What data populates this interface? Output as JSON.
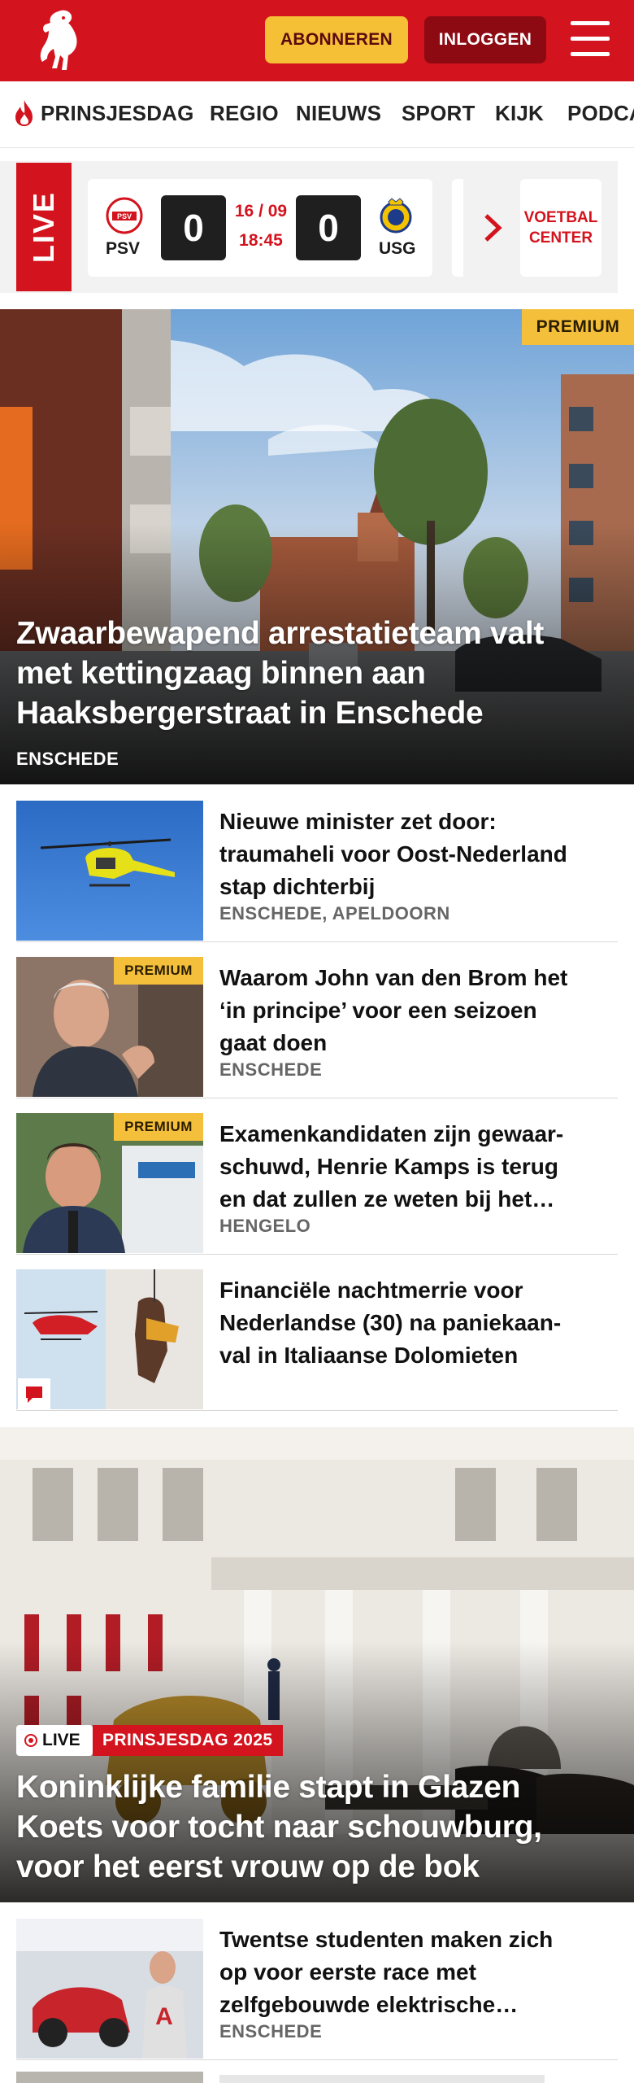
{
  "header": {
    "subscribe_label": "ABONNEREN",
    "login_label": "INLOGGEN",
    "colors": {
      "brand_red": "#d3131d",
      "subscribe_yellow": "#f5bf36",
      "login_dark_red": "#8e0a13"
    }
  },
  "nav": {
    "items": [
      {
        "label": "PRINSJESDAG",
        "icon": "flame-icon"
      },
      {
        "label": "REGIO"
      },
      {
        "label": "NIEUWS"
      },
      {
        "label": "SPORT"
      },
      {
        "label": "KIJK"
      },
      {
        "label": "PODCA"
      }
    ]
  },
  "live": {
    "label": "LIVE",
    "match": {
      "home": "PSV",
      "away": "USG",
      "home_score": "0",
      "away_score": "0",
      "date": "16 / 09",
      "time": "18:45"
    },
    "voetbal_center_line1": "VOETBAL",
    "voetbal_center_line2": "CENTER"
  },
  "hero1": {
    "badge": "PREMIUM",
    "title_lines": [
      "Zwaarbewapend arrestatieteam valt",
      "met kettingzaag binnen aan",
      "Haaksbergerstraat in Enschede"
    ],
    "location": "ENSCHEDE"
  },
  "articles": [
    {
      "title_lines": [
        "Nieuwe minister zet door:",
        "traumaheli voor Oost-Nederland",
        "stap dichterbij"
      ],
      "location": "ENSCHEDE, APELDOORN"
    },
    {
      "badge": "PREMIUM",
      "title_lines": [
        "Waarom John van den Brom het",
        "‘in principe’ voor een seizoen",
        "gaat doen"
      ],
      "location": "ENSCHEDE"
    },
    {
      "badge": "PREMIUM",
      "title_lines": [
        "Examenkandidaten zijn gewaar-",
        "schuwd, Henrie Kamps is terug",
        "en dat zullen ze weten bij het…"
      ],
      "location": "HENGELO"
    },
    {
      "title_lines": [
        "Financiële nachtmerrie voor",
        "Nederlandse (30) na paniekaan-",
        "val in Italiaanse Dolomieten"
      ],
      "location": ""
    }
  ],
  "hero2": {
    "live_label": "LIVE",
    "tag": "PRINSJESDAG 2025",
    "title_lines": [
      "Koninklijke familie stapt in Glazen",
      "Koets voor tocht naar schouwburg,",
      "voor het eerst vrouw op de bok"
    ]
  },
  "articles2": [
    {
      "title_lines": [
        "Twentse studenten maken zich",
        "op voor eerste race met",
        "zelfgebouwde elektrische…"
      ],
      "location": "ENSCHEDE"
    }
  ]
}
